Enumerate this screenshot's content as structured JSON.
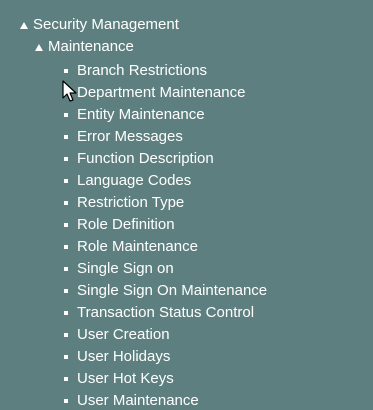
{
  "tree": {
    "root": {
      "label": "Security Management",
      "icon": "triangle-expanded-icon"
    },
    "group": {
      "label": "Maintenance",
      "icon": "triangle-expanded-icon"
    },
    "items": [
      {
        "label": "Branch Restrictions"
      },
      {
        "label": "Department Maintenance"
      },
      {
        "label": "Entity Maintenance"
      },
      {
        "label": "Error Messages"
      },
      {
        "label": "Function Description"
      },
      {
        "label": "Language Codes"
      },
      {
        "label": "Restriction Type"
      },
      {
        "label": "Role Definition"
      },
      {
        "label": "Role Maintenance"
      },
      {
        "label": "Single Sign on"
      },
      {
        "label": "Single Sign On Maintenance"
      },
      {
        "label": "Transaction Status Control"
      },
      {
        "label": "User Creation"
      },
      {
        "label": "User Holidays"
      },
      {
        "label": "User Hot Keys"
      },
      {
        "label": "User Maintenance"
      }
    ]
  },
  "colors": {
    "background": "#5e7f80",
    "text": "#ffffff"
  }
}
